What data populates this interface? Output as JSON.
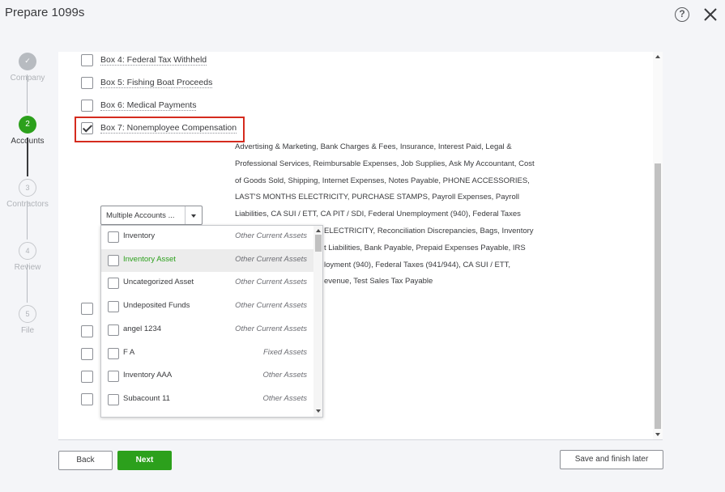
{
  "header": {
    "title": "Prepare 1099s",
    "help_icon": "?"
  },
  "stepper": [
    {
      "number": "✓",
      "label": "Company",
      "state": "done"
    },
    {
      "number": "2",
      "label": "Accounts",
      "state": "active"
    },
    {
      "number": "3",
      "label": "Contractors",
      "state": "todo"
    },
    {
      "number": "4",
      "label": "Review",
      "state": "todo"
    },
    {
      "number": "5",
      "label": "File",
      "state": "todo"
    }
  ],
  "boxes": [
    {
      "label": "Box 4: Federal Tax Withheld",
      "checked": false
    },
    {
      "label": "Box 5: Fishing Boat Proceeds",
      "checked": false
    },
    {
      "label": "Box 6: Medical Payments",
      "checked": false
    },
    {
      "label": "Box 7: Nonemployee Compensation",
      "checked": true
    }
  ],
  "accounts_lines": [
    "Advertising & Marketing, Bank Charges & Fees, Insurance, Interest Paid, Legal &",
    "Professional Services, Reimbursable Expenses, Job Supplies, Ask My Accountant, Cost",
    "of Goods Sold, Shipping, Internet Expenses, Notes Payable, PHONE ACCESSORIES,",
    "LAST'S MONTHS ELECTRICITY, PURCHASE STAMPS, Payroll Expenses, Payroll",
    "Liabilities, CA SUI / ETT, CA PIT / SDI, Federal Unemployment (940), Federal Taxes",
    "ELECTRICITY, Reconciliation Discrepancies, Bags, Inventory",
    "t Liabilities, Bank Payable, Prepaid Expenses Payable, IRS",
    "loyment (940), Federal Taxes (941/944), CA SUI / ETT,",
    "evenue, Test Sales Tax Payable"
  ],
  "select": {
    "value": "Multiple Accounts ..."
  },
  "dropdown_items": [
    {
      "name": "Inventory",
      "type": "Other Current Assets"
    },
    {
      "name": "Inventory Asset",
      "type": "Other Current Assets"
    },
    {
      "name": "Uncategorized Asset",
      "type": "Other Current Assets"
    },
    {
      "name": "Undeposited Funds",
      "type": "Other Current Assets"
    },
    {
      "name": "angel 1234",
      "type": "Other Current Assets"
    },
    {
      "name": "F A",
      "type": "Fixed Assets"
    },
    {
      "name": "Inventory AAA",
      "type": "Other Assets"
    },
    {
      "name": "Subacount 11",
      "type": "Other Assets"
    }
  ],
  "buttons": {
    "back": "Back",
    "next": "Next",
    "save": "Save and finish later"
  },
  "colors": {
    "accent": "#2ca01c",
    "highlight": "#d52b1e"
  }
}
